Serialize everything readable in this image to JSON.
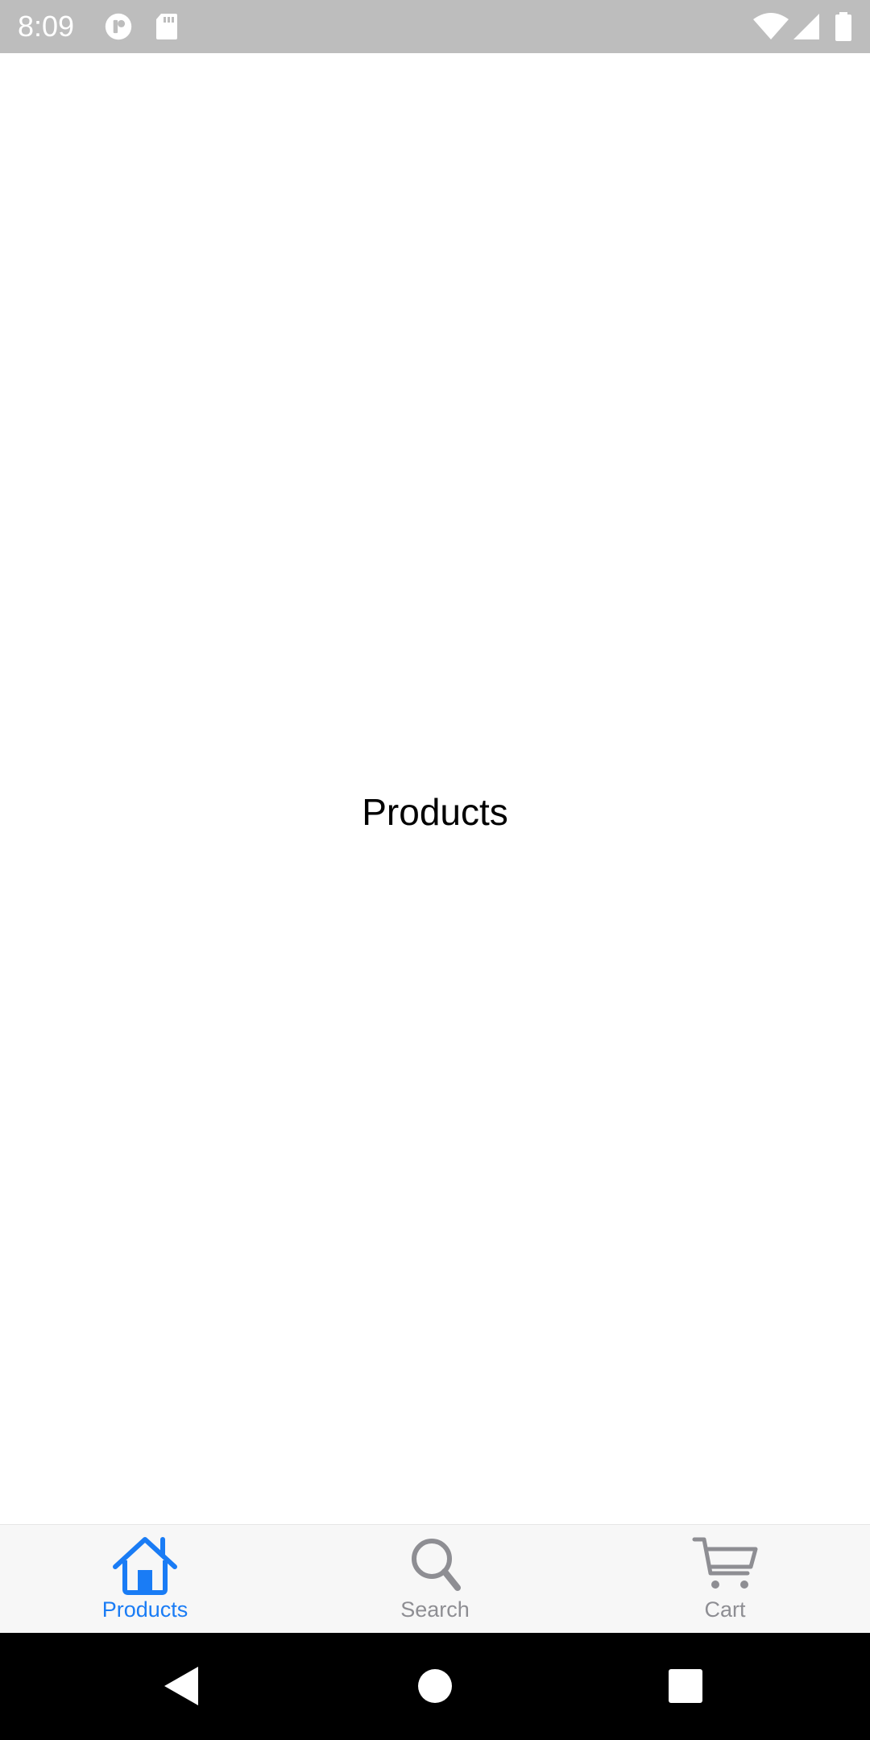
{
  "status_bar": {
    "time": "8:09",
    "left_icons": [
      "assistant-icon",
      "sd-card-icon"
    ],
    "right_icons": [
      "wifi-icon",
      "cell-signal-icon",
      "battery-icon"
    ],
    "background": "#bdbdbd"
  },
  "main": {
    "title": "Products"
  },
  "tab_bar": {
    "active_color": "#1a7cf5",
    "inactive_color": "#8e8e93",
    "tabs": [
      {
        "label": "Products",
        "icon": "home-icon",
        "active": true
      },
      {
        "label": "Search",
        "icon": "search-icon",
        "active": false
      },
      {
        "label": "Cart",
        "icon": "cart-icon",
        "active": false
      }
    ]
  },
  "nav_bar": {
    "buttons": [
      "back-icon",
      "home-circle-icon",
      "recents-icon"
    ]
  }
}
